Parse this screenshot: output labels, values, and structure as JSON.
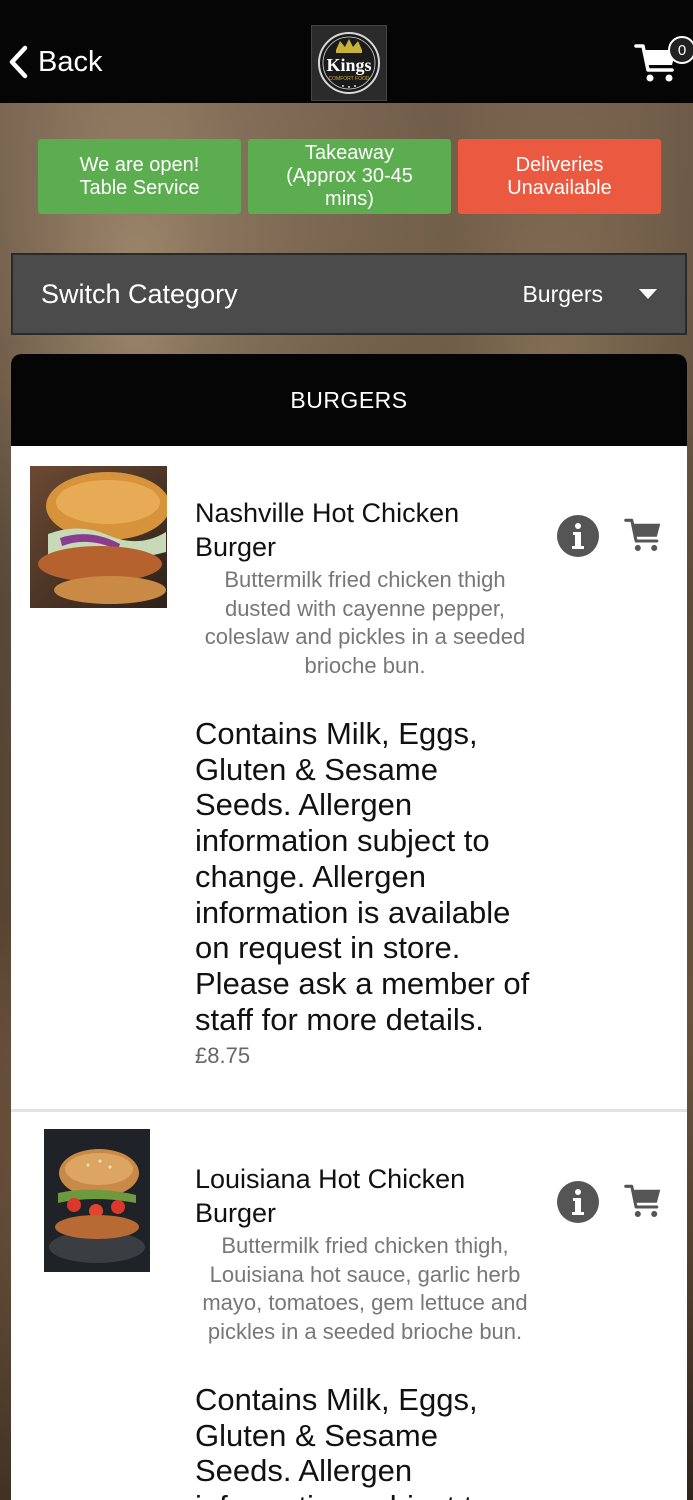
{
  "header": {
    "back_label": "Back",
    "logo_text": "Kings",
    "logo_subtext": "COMFORT FOOD",
    "cart_count": "0"
  },
  "status": [
    {
      "label": "We are open!\nTable Service",
      "color": "#5cad4f"
    },
    {
      "label": "Takeaway\n(Approx 30-45\nmins)",
      "color": "#5cad4f"
    },
    {
      "label": "Deliveries\nUnavailable",
      "color": "#ea5940"
    }
  ],
  "category": {
    "label": "Switch Category",
    "selected": "Burgers"
  },
  "section_title": "BURGERS",
  "items": [
    {
      "name": "Nashville Hot Chicken Burger",
      "description": "Buttermilk fried chicken thigh dusted with cayenne pepper, coleslaw and pickles in a seeded brioche bun.",
      "allergens": "Contains Milk, Eggs, Gluten & Sesame Seeds. Allergen information subject to change. Allergen information is available on request in store. Please ask a member of staff for more details.",
      "price": "£8.75"
    },
    {
      "name": "Louisiana Hot Chicken Burger",
      "description": "Buttermilk fried chicken thigh, Louisiana hot sauce, garlic herb mayo, tomatoes, gem lettuce and pickles in a seeded brioche bun.",
      "allergens": "Contains Milk, Eggs, Gluten & Sesame Seeds. Allergen information subject to change."
    }
  ]
}
